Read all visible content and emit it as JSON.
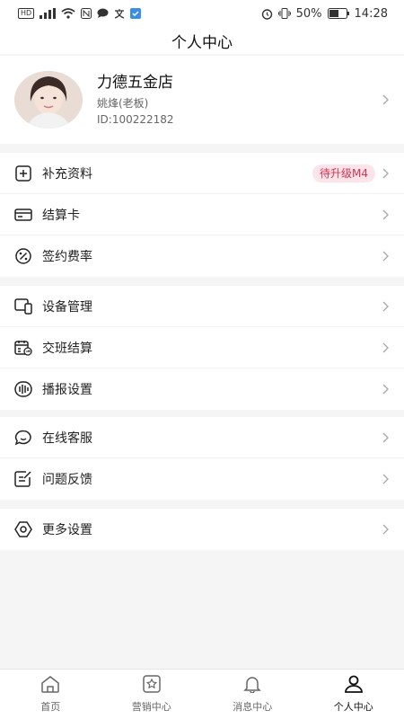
{
  "status_bar": {
    "left_badge": "HD",
    "signal_text": "4G",
    "battery": "50%",
    "time": "14:28"
  },
  "header": {
    "title": "个人中心"
  },
  "profile": {
    "shop_name": "力德五金店",
    "owner": "姚烽(老板)",
    "id": "ID:100222182"
  },
  "groups": [
    {
      "items": [
        {
          "label": "补充资料",
          "icon": "add-document-icon",
          "badge": "待升级M4"
        },
        {
          "label": "结算卡",
          "icon": "card-icon"
        },
        {
          "label": "签约费率",
          "icon": "percent-icon"
        }
      ]
    },
    {
      "items": [
        {
          "label": "设备管理",
          "icon": "device-icon"
        },
        {
          "label": "交班结算",
          "icon": "calendar-transfer-icon"
        },
        {
          "label": "播报设置",
          "icon": "sound-wave-icon"
        }
      ]
    },
    {
      "items": [
        {
          "label": "在线客服",
          "icon": "chat-icon"
        },
        {
          "label": "问题反馈",
          "icon": "edit-note-icon"
        }
      ]
    },
    {
      "items": [
        {
          "label": "更多设置",
          "icon": "settings-icon"
        }
      ]
    }
  ],
  "tabs": [
    {
      "label": "首页",
      "icon": "home-icon",
      "active": false
    },
    {
      "label": "营销中心",
      "icon": "marketing-icon",
      "active": false
    },
    {
      "label": "消息中心",
      "icon": "bell-icon",
      "active": false
    },
    {
      "label": "个人中心",
      "icon": "user-icon",
      "active": true
    }
  ],
  "colors": {
    "badge_bg": "#fde4ea",
    "badge_text": "#d9304f",
    "background": "#f5f5f5"
  }
}
